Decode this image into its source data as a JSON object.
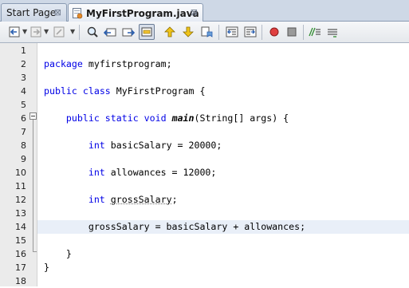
{
  "tabs": [
    {
      "label": "Start Page",
      "active": false
    },
    {
      "label": "MyFirstProgram.java",
      "active": true
    }
  ],
  "toolbar": {
    "buttons": [
      "back-history-icon",
      "forward-history-icon",
      "last-edit-icon",
      "find-icon",
      "find-previous-icon",
      "find-next-icon",
      "toggle-highlight-icon",
      "previous-bookmark-icon",
      "next-bookmark-icon",
      "toggle-bookmark-icon",
      "shift-left-icon",
      "shift-right-icon",
      "start-macro-icon",
      "stop-macro-icon",
      "comment-icon",
      "uncomment-icon"
    ]
  },
  "editor": {
    "colors": {
      "keyword": "#0000e6",
      "current_line": "#e9eff8",
      "gutter": "#ebebeb"
    },
    "lines": [
      {
        "n": "1",
        "tokens": []
      },
      {
        "n": "2",
        "tokens": [
          {
            "t": "package",
            "c": "kw"
          },
          {
            "t": " myfirstprogram;",
            "c": ""
          }
        ]
      },
      {
        "n": "3",
        "tokens": []
      },
      {
        "n": "4",
        "tokens": [
          {
            "t": "public",
            "c": "kw"
          },
          {
            "t": " ",
            "c": ""
          },
          {
            "t": "class",
            "c": "kw"
          },
          {
            "t": " MyFirstProgram {",
            "c": ""
          }
        ]
      },
      {
        "n": "5",
        "tokens": []
      },
      {
        "n": "6",
        "tokens": [
          {
            "t": "    ",
            "c": ""
          },
          {
            "t": "public",
            "c": "kw"
          },
          {
            "t": " ",
            "c": ""
          },
          {
            "t": "static",
            "c": "kw"
          },
          {
            "t": " ",
            "c": ""
          },
          {
            "t": "void",
            "c": "kw"
          },
          {
            "t": " ",
            "c": ""
          },
          {
            "t": "main",
            "c": "mth"
          },
          {
            "t": "(String[] args) {",
            "c": ""
          }
        ]
      },
      {
        "n": "7",
        "tokens": []
      },
      {
        "n": "8",
        "tokens": [
          {
            "t": "        ",
            "c": ""
          },
          {
            "t": "int",
            "c": "kw"
          },
          {
            "t": " basicSalary = 20000;",
            "c": ""
          }
        ]
      },
      {
        "n": "9",
        "tokens": []
      },
      {
        "n": "10",
        "tokens": [
          {
            "t": "        ",
            "c": ""
          },
          {
            "t": "int",
            "c": "kw"
          },
          {
            "t": " allowances = 12000;",
            "c": ""
          }
        ]
      },
      {
        "n": "11",
        "tokens": []
      },
      {
        "n": "12",
        "tokens": [
          {
            "t": "        ",
            "c": ""
          },
          {
            "t": "int",
            "c": "kw"
          },
          {
            "t": " ",
            "c": ""
          },
          {
            "t": "grossSalary",
            "c": "uline"
          },
          {
            "t": ";",
            "c": ""
          }
        ]
      },
      {
        "n": "13",
        "tokens": []
      },
      {
        "n": "14",
        "tokens": [
          {
            "t": "        grossSalary = basicSalary + allowances;",
            "c": ""
          }
        ],
        "current": true
      },
      {
        "n": "15",
        "tokens": []
      },
      {
        "n": "16",
        "tokens": [
          {
            "t": "    }",
            "c": ""
          }
        ]
      },
      {
        "n": "17",
        "tokens": [
          {
            "t": "}",
            "c": ""
          }
        ]
      },
      {
        "n": "18",
        "tokens": []
      }
    ]
  }
}
